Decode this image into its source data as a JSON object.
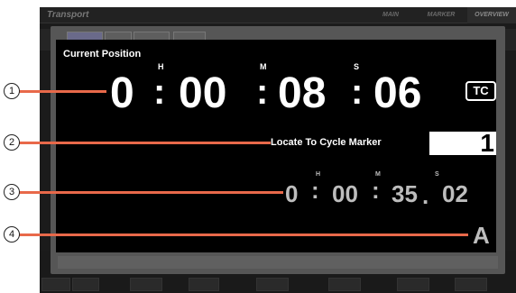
{
  "app": {
    "title": "Transport",
    "tabs": [
      "MAIN",
      "MARKER",
      "OVERVIEW"
    ]
  },
  "overlay": {
    "current_position": {
      "label": "Current Position",
      "units": {
        "hours": "H",
        "minutes": "M",
        "seconds": "S"
      },
      "hours": "0",
      "minutes": "00",
      "seconds": "08",
      "frames": "06",
      "format_badge": "TC"
    },
    "locate": {
      "label": "Locate To Cycle Marker",
      "value": "1"
    },
    "cycle_position": {
      "units": {
        "hours": "H",
        "minutes": "M",
        "seconds": "S"
      },
      "hours": "0",
      "minutes": "00",
      "seconds": "35",
      "frames": "02",
      "separator_dot": "."
    },
    "marker_letter": "A"
  },
  "callouts": [
    "1",
    "2",
    "3",
    "4"
  ],
  "colors": {
    "leader": "#e8694a",
    "panel": "#000000",
    "overlay": "#565656"
  }
}
